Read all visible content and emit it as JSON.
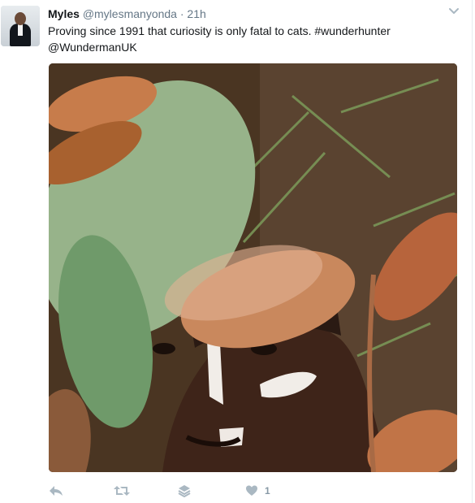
{
  "tweet": {
    "author": {
      "name": "Myles",
      "handle": "@mylesmanyonda",
      "avatar_icon": "profile-photo"
    },
    "separator": "·",
    "timestamp": "21h",
    "text_lines": [
      "Proving since 1991 that curiosity is only fatal to cats. #wunderhunter",
      "@WundermanUK"
    ],
    "media": {
      "type": "photo",
      "icon": "photo"
    },
    "actions": {
      "reply_icon": "reply-icon",
      "retweet_icon": "retweet-icon",
      "moments_icon": "stack-icon",
      "like_icon": "heart-icon",
      "like_count": "1"
    },
    "menu_icon": "chevron-down-icon"
  },
  "colors": {
    "text": "#14171a",
    "muted": "#657786",
    "action": "#aab8c2",
    "link_blue": "#1da1f2"
  }
}
